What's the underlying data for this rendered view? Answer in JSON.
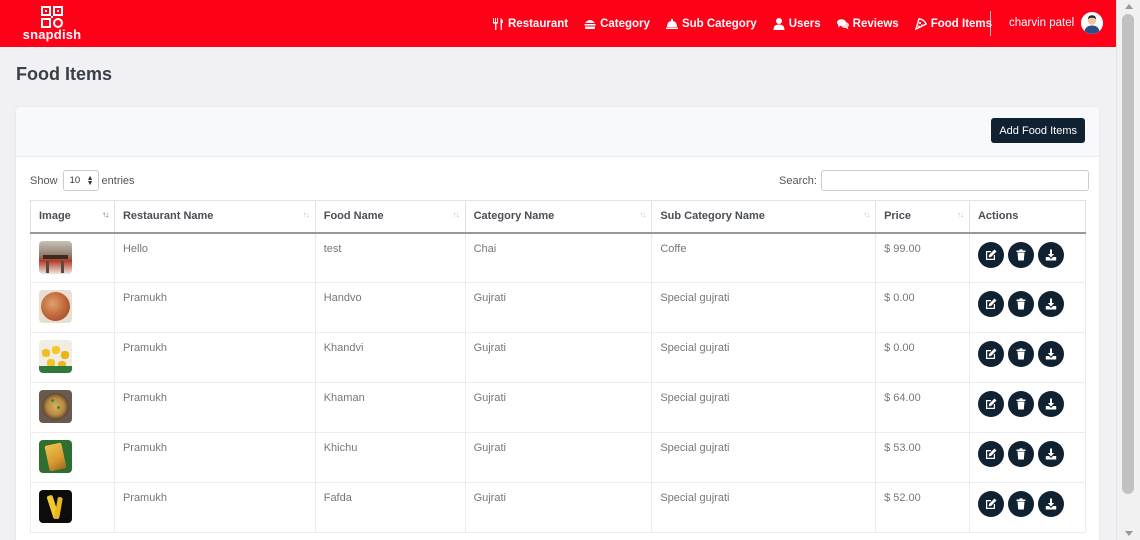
{
  "brand": {
    "name": "snapdish"
  },
  "nav": [
    {
      "label": "Restaurant",
      "icon": "utensils-icon"
    },
    {
      "label": "Category",
      "icon": "burger-icon"
    },
    {
      "label": "Sub Category",
      "icon": "cloche-icon"
    },
    {
      "label": "Users",
      "icon": "user-icon"
    },
    {
      "label": "Reviews",
      "icon": "comments-icon"
    },
    {
      "label": "Food Items",
      "icon": "pizza-icon"
    }
  ],
  "user": {
    "name": "charvin patel"
  },
  "page": {
    "title": "Food Items"
  },
  "card": {
    "add_label": "Add Food Items"
  },
  "controls": {
    "show_label": "Show",
    "entries_value": "10",
    "entries_label": "entries",
    "search_label": "Search:"
  },
  "table": {
    "columns": [
      "Image",
      "Restaurant Name",
      "Food Name",
      "Category Name",
      "Sub Category Name",
      "Price",
      "Actions"
    ],
    "rows": [
      {
        "restaurant": "Hello",
        "food": "test",
        "category": "Chai",
        "subcategory": "Coffe",
        "price": "$ 99.00"
      },
      {
        "restaurant": "Pramukh",
        "food": "Handvo",
        "category": "Gujrati",
        "subcategory": "Special gujrati",
        "price": "$ 0.00"
      },
      {
        "restaurant": "Pramukh",
        "food": "Khandvi",
        "category": "Gujrati",
        "subcategory": "Special gujrati",
        "price": "$ 0.00"
      },
      {
        "restaurant": "Pramukh",
        "food": "Khaman",
        "category": "Gujrati",
        "subcategory": "Special gujrati",
        "price": "$ 64.00"
      },
      {
        "restaurant": "Pramukh",
        "food": "Khichu",
        "category": "Gujrati",
        "subcategory": "Special gujrati",
        "price": "$ 53.00"
      },
      {
        "restaurant": "Pramukh",
        "food": "Fafda",
        "category": "Gujrati",
        "subcategory": "Special gujrati",
        "price": "$ 52.00"
      }
    ]
  },
  "colors": {
    "header": "#fe0017",
    "dark": "#102232",
    "background": "#f1f1f3"
  }
}
